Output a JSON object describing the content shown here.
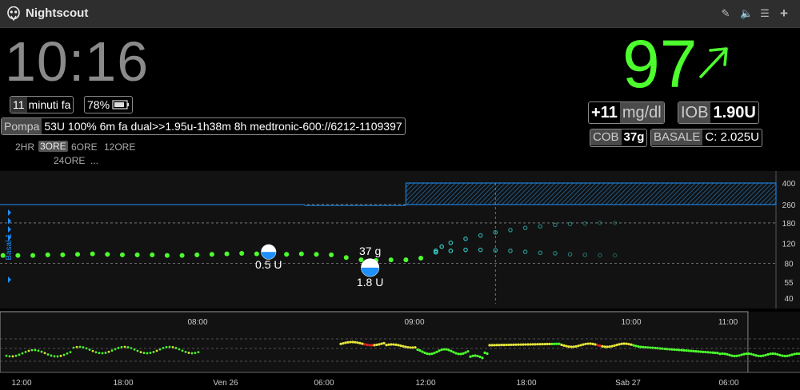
{
  "app": {
    "title": "Nightscout"
  },
  "toolbar": {
    "icons": [
      "edit-icon",
      "volume-icon",
      "menu-icon",
      "plus-icon"
    ]
  },
  "clock": "10:16",
  "status": {
    "minutes_num": "11",
    "minutes_text": "minuti fa",
    "battery": "78%"
  },
  "pump": {
    "label": "Pompa",
    "value": "53U 100% 6m fa dual>>1.95u-1h38m 8h medtronic-600://6212-1109397"
  },
  "time_ranges": {
    "items": [
      "2HR",
      "3ORE",
      "6ORE",
      "12ORE",
      "24ORE",
      "..."
    ],
    "selected": "3ORE"
  },
  "bg": {
    "value": "97",
    "direction": "SingleUp",
    "delta": "+11",
    "units": "mg/dl"
  },
  "iob": {
    "label": "IOB",
    "value": "1.90U"
  },
  "cob": {
    "label": "COB",
    "value": "37g"
  },
  "basal": {
    "label": "BASALE",
    "value": "C: 2.025U"
  },
  "colors": {
    "in_range": "#4cff2d",
    "prediction": "#36d7d3",
    "basal": "#1e90ff",
    "high": "#e5e53a",
    "urgent": "#e02020"
  },
  "chart_data": {
    "type": "scatter",
    "main": {
      "y_ticks": [
        400,
        260,
        180,
        120,
        80,
        55,
        40
      ],
      "y_scale": "log",
      "x_labels": [
        "08:00",
        "09:00",
        "10:00",
        "11:00"
      ],
      "x_range": [
        "07:30",
        "11:50"
      ],
      "basal_label": "Basal 1",
      "sgv": [
        {
          "t": "07:31",
          "v": 94
        },
        {
          "t": "07:36",
          "v": 94
        },
        {
          "t": "07:41",
          "v": 94
        },
        {
          "t": "07:46",
          "v": 95
        },
        {
          "t": "07:51",
          "v": 95
        },
        {
          "t": "07:56",
          "v": 96
        },
        {
          "t": "08:01",
          "v": 97
        },
        {
          "t": "08:06",
          "v": 96
        },
        {
          "t": "08:11",
          "v": 95
        },
        {
          "t": "08:16",
          "v": 95
        },
        {
          "t": "08:21",
          "v": 95
        },
        {
          "t": "08:26",
          "v": 94
        },
        {
          "t": "08:31",
          "v": 94
        },
        {
          "t": "08:36",
          "v": 95
        },
        {
          "t": "08:41",
          "v": 96
        },
        {
          "t": "08:46",
          "v": 97
        },
        {
          "t": "08:51",
          "v": 98
        },
        {
          "t": "08:56",
          "v": 97
        },
        {
          "t": "09:01",
          "v": 96
        },
        {
          "t": "09:06",
          "v": 96
        },
        {
          "t": "09:11",
          "v": 97
        },
        {
          "t": "09:16",
          "v": 96
        },
        {
          "t": "09:21",
          "v": 95
        },
        {
          "t": "09:26",
          "v": 90
        },
        {
          "t": "09:31",
          "v": 86
        },
        {
          "t": "09:36",
          "v": 85
        },
        {
          "t": "09:41",
          "v": 86
        },
        {
          "t": "09:46",
          "v": 86
        },
        {
          "t": "09:51",
          "v": 89
        }
      ],
      "forecast": [
        {
          "t": "09:56",
          "v": 103
        },
        {
          "t": "09:58",
          "v": 112
        },
        {
          "t": "10:01",
          "v": 121
        },
        {
          "t": "10:06",
          "v": 131
        },
        {
          "t": "10:11",
          "v": 140
        },
        {
          "t": "10:16",
          "v": 149
        },
        {
          "t": "10:21",
          "v": 156
        },
        {
          "t": "10:26",
          "v": 163
        },
        {
          "t": "10:31",
          "v": 168
        },
        {
          "t": "10:36",
          "v": 173
        },
        {
          "t": "10:41",
          "v": 176
        },
        {
          "t": "10:46",
          "v": 178
        },
        {
          "t": "10:51",
          "v": 180
        },
        {
          "t": "10:56",
          "v": 180
        },
        {
          "t": "09:56",
          "v": 100
        },
        {
          "t": "10:01",
          "v": 103
        },
        {
          "t": "10:06",
          "v": 105
        },
        {
          "t": "10:11",
          "v": 105
        },
        {
          "t": "10:16",
          "v": 104
        },
        {
          "t": "10:21",
          "v": 103
        },
        {
          "t": "10:26",
          "v": 101
        },
        {
          "t": "10:31",
          "v": 99
        },
        {
          "t": "10:36",
          "v": 98
        },
        {
          "t": "10:41",
          "v": 96
        },
        {
          "t": "10:46",
          "v": 95
        },
        {
          "t": "10:51",
          "v": 94
        },
        {
          "t": "10:56",
          "v": 94
        }
      ],
      "treatments": [
        {
          "t": "09:00",
          "insulin": "0.5 U",
          "carbs": ""
        },
        {
          "t": "09:34",
          "insulin": "1.8 U",
          "carbs": "37 g"
        }
      ],
      "basal_temp": [
        {
          "from": "07:30",
          "to": "09:12",
          "v": 260
        },
        {
          "from": "09:12",
          "to": "09:46",
          "v": 255
        },
        {
          "from": "09:46",
          "to": "11:50",
          "v": 400
        }
      ],
      "now": "10:16"
    },
    "context": {
      "x_labels_top": [
        "08:00",
        "09:00",
        "10:00",
        "11:00"
      ],
      "x_labels_bottom": [
        "12:00",
        "18:00",
        "Ven 26",
        "06:00",
        "12:00",
        "18:00",
        "Sab 27",
        "06:00"
      ],
      "label_pos_top": [
        0.247,
        0.518,
        0.789,
        0.91
      ],
      "label_pos_bottom": [
        0.027,
        0.154,
        0.282,
        0.405,
        0.532,
        0.658,
        0.785,
        0.911
      ]
    }
  }
}
